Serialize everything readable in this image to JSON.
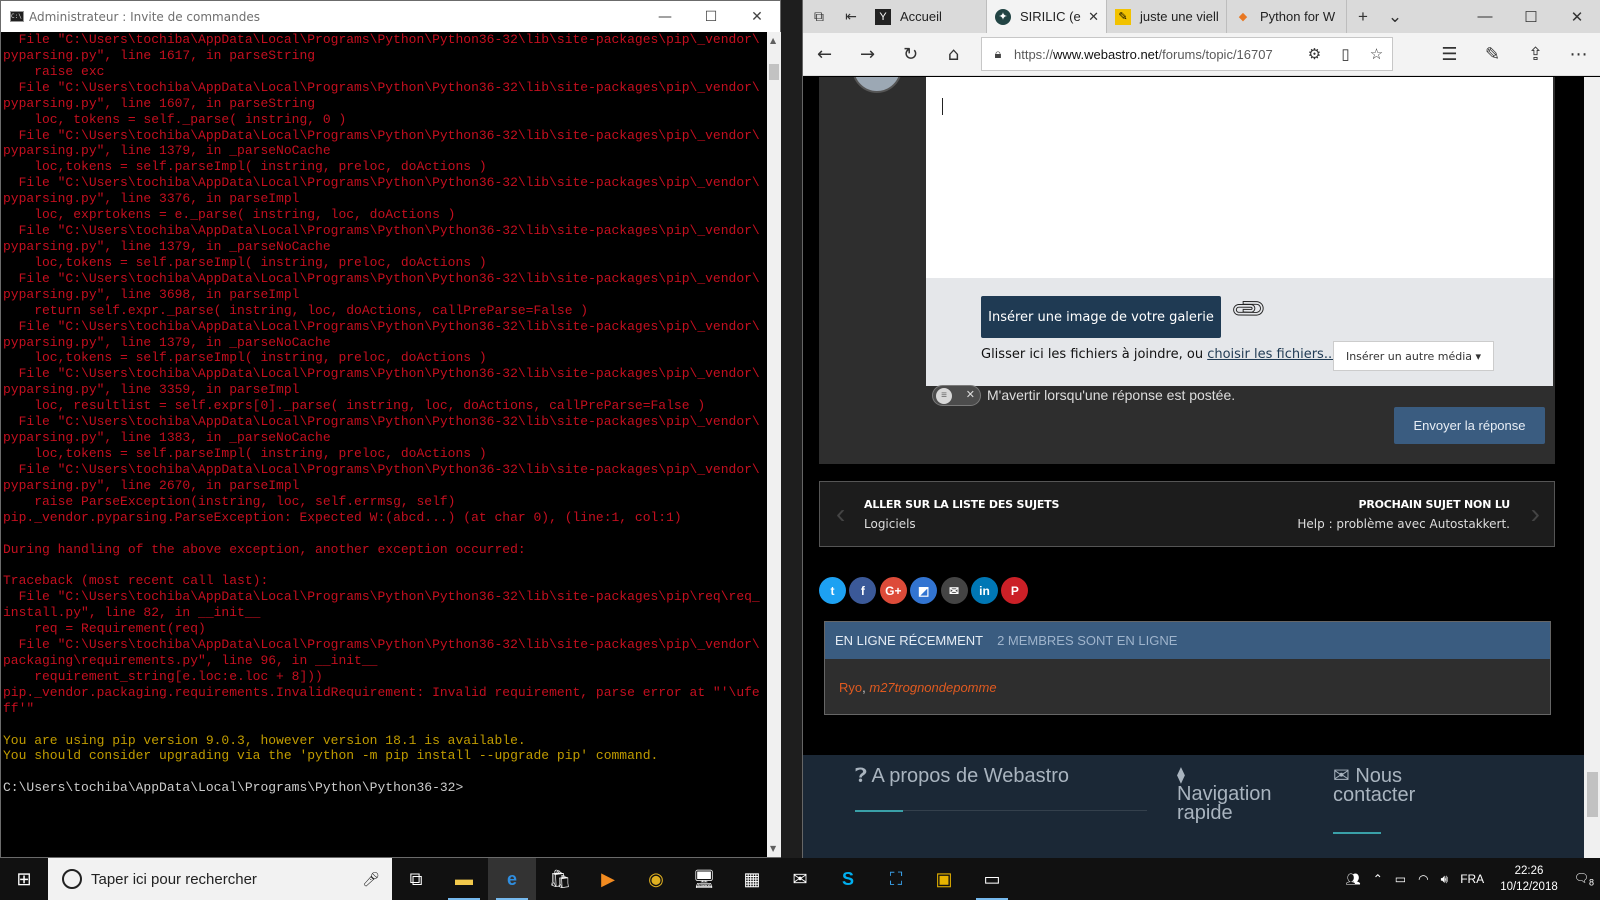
{
  "cmd": {
    "title": "Administrateur : Invite de commandes",
    "lines": [
      {
        "t": "  File \"C:\\Users\\tochiba\\AppData\\Local\\Programs\\Python\\Python36-32\\lib\\site-packages\\pip\\_vendor\\",
        "c": "r"
      },
      {
        "t": "pyparsing.py\", line 1617, in parseString",
        "c": "r"
      },
      {
        "t": "    raise exc",
        "c": "r"
      },
      {
        "t": "  File \"C:\\Users\\tochiba\\AppData\\Local\\Programs\\Python\\Python36-32\\lib\\site-packages\\pip\\_vendor\\",
        "c": "r"
      },
      {
        "t": "pyparsing.py\", line 1607, in parseString",
        "c": "r"
      },
      {
        "t": "    loc, tokens = self._parse( instring, 0 )",
        "c": "r"
      },
      {
        "t": "  File \"C:\\Users\\tochiba\\AppData\\Local\\Programs\\Python\\Python36-32\\lib\\site-packages\\pip\\_vendor\\",
        "c": "r"
      },
      {
        "t": "pyparsing.py\", line 1379, in _parseNoCache",
        "c": "r"
      },
      {
        "t": "    loc,tokens = self.parseImpl( instring, preloc, doActions )",
        "c": "r"
      },
      {
        "t": "  File \"C:\\Users\\tochiba\\AppData\\Local\\Programs\\Python\\Python36-32\\lib\\site-packages\\pip\\_vendor\\",
        "c": "r"
      },
      {
        "t": "pyparsing.py\", line 3376, in parseImpl",
        "c": "r"
      },
      {
        "t": "    loc, exprtokens = e._parse( instring, loc, doActions )",
        "c": "r"
      },
      {
        "t": "  File \"C:\\Users\\tochiba\\AppData\\Local\\Programs\\Python\\Python36-32\\lib\\site-packages\\pip\\_vendor\\",
        "c": "r"
      },
      {
        "t": "pyparsing.py\", line 1379, in _parseNoCache",
        "c": "r"
      },
      {
        "t": "    loc,tokens = self.parseImpl( instring, preloc, doActions )",
        "c": "r"
      },
      {
        "t": "  File \"C:\\Users\\tochiba\\AppData\\Local\\Programs\\Python\\Python36-32\\lib\\site-packages\\pip\\_vendor\\",
        "c": "r"
      },
      {
        "t": "pyparsing.py\", line 3698, in parseImpl",
        "c": "r"
      },
      {
        "t": "    return self.expr._parse( instring, loc, doActions, callPreParse=False )",
        "c": "r"
      },
      {
        "t": "  File \"C:\\Users\\tochiba\\AppData\\Local\\Programs\\Python\\Python36-32\\lib\\site-packages\\pip\\_vendor\\",
        "c": "r"
      },
      {
        "t": "pyparsing.py\", line 1379, in _parseNoCache",
        "c": "r"
      },
      {
        "t": "    loc,tokens = self.parseImpl( instring, preloc, doActions )",
        "c": "r"
      },
      {
        "t": "  File \"C:\\Users\\tochiba\\AppData\\Local\\Programs\\Python\\Python36-32\\lib\\site-packages\\pip\\_vendor\\",
        "c": "r"
      },
      {
        "t": "pyparsing.py\", line 3359, in parseImpl",
        "c": "r"
      },
      {
        "t": "    loc, resultlist = self.exprs[0]._parse( instring, loc, doActions, callPreParse=False )",
        "c": "r"
      },
      {
        "t": "  File \"C:\\Users\\tochiba\\AppData\\Local\\Programs\\Python\\Python36-32\\lib\\site-packages\\pip\\_vendor\\",
        "c": "r"
      },
      {
        "t": "pyparsing.py\", line 1383, in _parseNoCache",
        "c": "r"
      },
      {
        "t": "    loc,tokens = self.parseImpl( instring, preloc, doActions )",
        "c": "r"
      },
      {
        "t": "  File \"C:\\Users\\tochiba\\AppData\\Local\\Programs\\Python\\Python36-32\\lib\\site-packages\\pip\\_vendor\\",
        "c": "r"
      },
      {
        "t": "pyparsing.py\", line 2670, in parseImpl",
        "c": "r"
      },
      {
        "t": "    raise ParseException(instring, loc, self.errmsg, self)",
        "c": "r"
      },
      {
        "t": "pip._vendor.pyparsing.ParseException: Expected W:(abcd...) (at char 0), (line:1, col:1)",
        "c": "r"
      },
      {
        "t": "",
        "c": "r"
      },
      {
        "t": "During handling of the above exception, another exception occurred:",
        "c": "r"
      },
      {
        "t": "",
        "c": "r"
      },
      {
        "t": "Traceback (most recent call last):",
        "c": "r"
      },
      {
        "t": "  File \"C:\\Users\\tochiba\\AppData\\Local\\Programs\\Python\\Python36-32\\lib\\site-packages\\pip\\req\\req_",
        "c": "r"
      },
      {
        "t": "install.py\", line 82, in __init__",
        "c": "r"
      },
      {
        "t": "    req = Requirement(req)",
        "c": "r"
      },
      {
        "t": "  File \"C:\\Users\\tochiba\\AppData\\Local\\Programs\\Python\\Python36-32\\lib\\site-packages\\pip\\_vendor\\",
        "c": "r"
      },
      {
        "t": "packaging\\requirements.py\", line 96, in __init__",
        "c": "r"
      },
      {
        "t": "    requirement_string[e.loc:e.loc + 8]))",
        "c": "r"
      },
      {
        "t": "pip._vendor.packaging.requirements.InvalidRequirement: Invalid requirement, parse error at \"'\\ufe",
        "c": "r"
      },
      {
        "t": "ff'\"",
        "c": "r"
      },
      {
        "t": "",
        "c": "r"
      },
      {
        "t": "You are using pip version 9.0.3, however version 18.1 is available.",
        "c": "y"
      },
      {
        "t": "You should consider upgrading via the 'python -m pip install --upgrade pip' command.",
        "c": "y"
      },
      {
        "t": "",
        "c": "w"
      },
      {
        "t": "C:\\Users\\tochiba\\AppData\\Local\\Programs\\Python\\Python36-32>",
        "c": "w"
      }
    ]
  },
  "browser": {
    "tabs": [
      {
        "label": "Accueil",
        "icon": "accueil-favicon",
        "active": false
      },
      {
        "label": "SIRILIC (e",
        "icon": "webastro-favicon",
        "active": true
      },
      {
        "label": "juste une viell",
        "icon": "note-favicon",
        "active": false
      },
      {
        "label": "Python for W",
        "icon": "python-favicon",
        "active": false
      }
    ],
    "url_prefix": "https://",
    "url_domain": "www.webastro.net",
    "url_path": "/forums/topic/16707",
    "page": {
      "gallery_button": "Insérer une image de votre galerie",
      "drop_text": "Glisser ici les fichiers à joindre, ou",
      "choose_link": "choisir les fichiers...",
      "other_media": "Insérer un autre média ▾",
      "notify": "M'avertir lorsqu'une réponse est postée.",
      "send": "Envoyer la réponse",
      "prev_heading": "ALLER SUR LA LISTE DES SUJETS",
      "prev_sub": "Logiciels",
      "next_heading": "PROCHAIN SUJET NON LU",
      "next_sub": "Help : problème avec Autostakkert.",
      "online_title": "EN LIGNE RÉCEMMENT",
      "online_count": "2 MEMBRES SONT EN LIGNE",
      "member1": "Ryo",
      "member_sep": ",",
      "member2": "m27trognondepomme",
      "footer_about": "A propos de Webastro",
      "footer_nav_line1": "Navigation",
      "footer_nav_line2": "rapide",
      "footer_contact_line1": "Nous",
      "footer_contact_line2": "contacter"
    },
    "social": [
      {
        "name": "twitter",
        "glyph": "t",
        "color": "#1da1f2"
      },
      {
        "name": "facebook",
        "glyph": "f",
        "color": "#3b5998"
      },
      {
        "name": "google-plus",
        "glyph": "G+",
        "color": "#dd4b39"
      },
      {
        "name": "delicious",
        "glyph": "◩",
        "color": "#3274d1"
      },
      {
        "name": "email",
        "glyph": "✉",
        "color": "#444444"
      },
      {
        "name": "linkedin",
        "glyph": "in",
        "color": "#0077b5"
      },
      {
        "name": "pinterest",
        "glyph": "P",
        "color": "#cb2027"
      }
    ]
  },
  "taskbar": {
    "search_placeholder": "Taper ici pour rechercher",
    "lang": "FRA",
    "time": "22:26",
    "date": "10/12/2018",
    "notifications": "8"
  }
}
